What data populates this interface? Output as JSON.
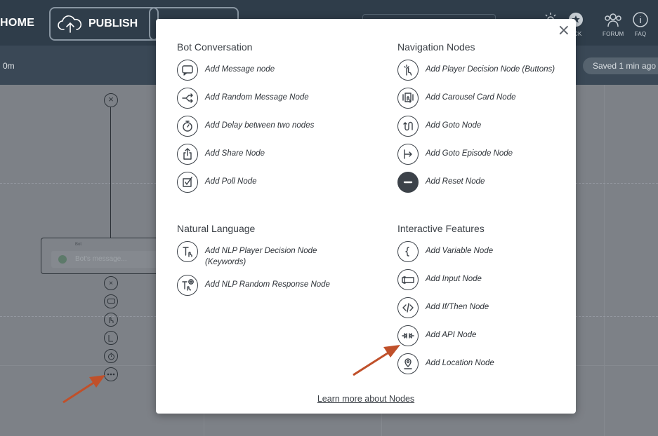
{
  "topbar": {
    "home_label": "HOME",
    "publish_label": "PUBLISH",
    "icons": [
      {
        "name": "settings-icon",
        "label": ""
      },
      {
        "name": "feedback-icon",
        "label": "ACK"
      },
      {
        "name": "forum-icon",
        "label": "FORUM"
      },
      {
        "name": "faq-icon",
        "label": "FAQ"
      }
    ]
  },
  "subbar": {
    "left_text": "0m",
    "saved_text": "Saved 1 min ago"
  },
  "canvas": {
    "bot_label": "Bot",
    "bot_placeholder": "Bot's message..."
  },
  "modal": {
    "close_label": "×",
    "sections": {
      "bot_conversation": {
        "title": "Bot Conversation",
        "items": [
          {
            "label": "Add Message node",
            "icon": "message-icon"
          },
          {
            "label": "Add Random Message Node",
            "icon": "random-icon"
          },
          {
            "label": "Add Delay between two nodes",
            "icon": "stopwatch-icon"
          },
          {
            "label": "Add Share Node",
            "icon": "share-icon"
          },
          {
            "label": "Add Poll Node",
            "icon": "poll-icon"
          }
        ]
      },
      "navigation_nodes": {
        "title": "Navigation Nodes",
        "items": [
          {
            "label": "Add Player Decision Node (Buttons)",
            "icon": "tap-icon"
          },
          {
            "label": "Add Carousel Card Node",
            "icon": "carousel-icon"
          },
          {
            "label": "Add Goto Node",
            "icon": "goto-icon"
          },
          {
            "label": "Add Goto Episode Node",
            "icon": "goto-episode-icon"
          },
          {
            "label": "Add Reset Node",
            "icon": "reset-icon"
          }
        ]
      },
      "natural_language": {
        "title": "Natural Language",
        "items": [
          {
            "label": "Add NLP Player Decision Node (Keywords)",
            "icon": "nlp-decision-icon"
          },
          {
            "label": "Add NLP Random Response Node",
            "icon": "nlp-random-icon"
          }
        ]
      },
      "interactive_features": {
        "title": "Interactive Features",
        "items": [
          {
            "label": "Add Variable Node",
            "icon": "variable-icon"
          },
          {
            "label": "Add Input Node",
            "icon": "input-icon"
          },
          {
            "label": "Add If/Then Node",
            "icon": "code-icon"
          },
          {
            "label": "Add API Node",
            "icon": "api-icon"
          },
          {
            "label": "Add Location Node",
            "icon": "location-icon"
          }
        ]
      }
    },
    "learn_more": "Learn more about Nodes"
  },
  "colors": {
    "topbar": "#2f3d4a",
    "subbar": "#3a4856",
    "canvas": "#7d8187",
    "modal_bg": "#ffffff",
    "annotation_arrow": "#c0502a"
  }
}
